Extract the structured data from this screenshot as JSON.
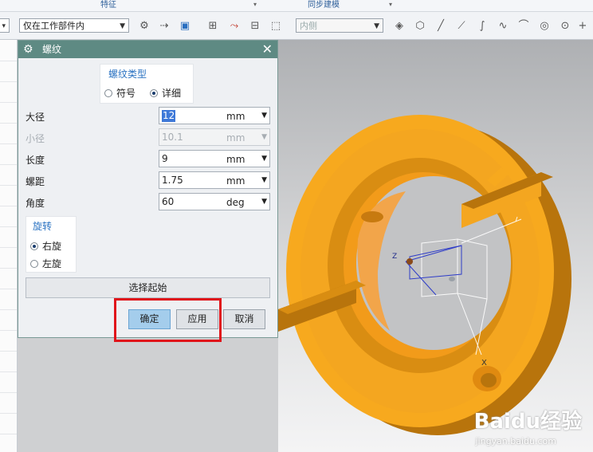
{
  "ribbon": {
    "group_features": "特征",
    "group_sync_modeling": "同步建模"
  },
  "toolbar": {
    "scope_combo_value": "仅在工作部件内",
    "inner_combo_value": "内侧",
    "icons": [
      "part-nav-icon",
      "snap-icon",
      "assembly-icon",
      "add-component-icon",
      "move-icon",
      "constraint-icon",
      "select-box-icon",
      "view-icon",
      "cube-icon",
      "line-icon",
      "diagonal-icon",
      "curve-icon",
      "spline-icon",
      "arc-icon",
      "circle-icon",
      "point-icon",
      "plus-icon"
    ]
  },
  "dialog": {
    "title": "螺纹",
    "thread_type": {
      "heading": "螺纹类型",
      "options": [
        "符号",
        "详细"
      ],
      "selected": "详细"
    },
    "fields": [
      {
        "label": "大径",
        "value": "12",
        "unit": "mm",
        "enabled": true,
        "selected_text": true
      },
      {
        "label": "小径",
        "value": "10.1",
        "unit": "mm",
        "enabled": false,
        "selected_text": false
      },
      {
        "label": "长度",
        "value": "9",
        "unit": "mm",
        "enabled": true,
        "selected_text": false
      },
      {
        "label": "螺距",
        "value": "1.75",
        "unit": "mm",
        "enabled": true,
        "selected_text": false
      },
      {
        "label": "角度",
        "value": "60",
        "unit": "deg",
        "enabled": true,
        "selected_text": false
      }
    ],
    "rotation": {
      "heading": "旋转",
      "options": [
        "右旋",
        "左旋"
      ],
      "selected": "右旋"
    },
    "select_start_label": "选择起始",
    "buttons": {
      "ok": "确定",
      "apply": "应用",
      "cancel": "取消"
    }
  },
  "viewport": {
    "axis_labels": {
      "z": "Z",
      "x": "X"
    },
    "part_color": "#f4a620",
    "part_shadow_color": "#b8740c"
  },
  "watermark": {
    "brand": "Baidu经验",
    "url": "jingyan.baidu.com"
  },
  "colors": {
    "dialog_title_bar": "#5e8a83",
    "accent_blue": "#2b73c2",
    "highlight_red": "#e0141b",
    "primary_button": "#a4cdec"
  }
}
